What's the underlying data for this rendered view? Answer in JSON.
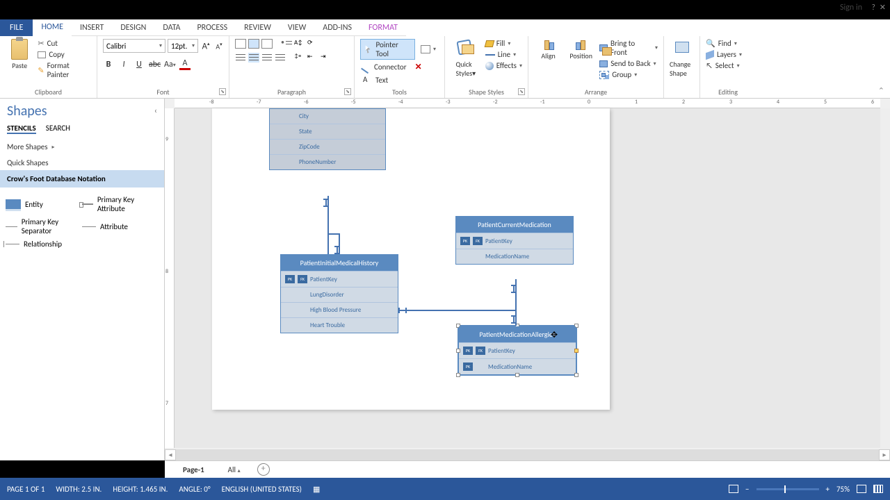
{
  "signin": "Sign in",
  "winbtns": {
    "close": "✕",
    "help": "?"
  },
  "tabs": {
    "file": "FILE",
    "home": "HOME",
    "insert": "INSERT",
    "design": "DESIGN",
    "data": "DATA",
    "process": "PROCESS",
    "review": "REVIEW",
    "view": "VIEW",
    "addins": "ADD-INS",
    "format": "FORMAT"
  },
  "ribbon": {
    "clipboard": {
      "label": "Clipboard",
      "paste": "Paste",
      "cut": "Cut",
      "copy": "Copy",
      "painter": "Format Painter"
    },
    "font": {
      "label": "Font",
      "name": "Calibri",
      "size": "12pt."
    },
    "paragraph": {
      "label": "Paragraph"
    },
    "tools": {
      "label": "Tools",
      "pointer": "Pointer Tool",
      "connector": "Connector",
      "text": "Text"
    },
    "shapestyles": {
      "label": "Shape Styles",
      "fill": "Fill",
      "line": "Line",
      "effects": "Effects"
    },
    "arrange": {
      "label": "Arrange",
      "align": "Align",
      "position": "Position",
      "front": "Bring to Front",
      "back": "Send to Back",
      "group": "Group"
    },
    "change": {
      "change": "Change Shape"
    },
    "editing": {
      "label": "Editing",
      "find": "Find",
      "layers": "Layers",
      "select": "Select"
    }
  },
  "shapespane": {
    "title": "Shapes",
    "stencils": "STENCILS",
    "search": "SEARCH",
    "more": "More Shapes",
    "quick": "Quick Shapes",
    "current": "Crow's Foot Database Notation",
    "items": {
      "entity": "Entity",
      "pka": "Primary Key Attribute",
      "pks": "Primary Key Separator",
      "attr": "Attribute",
      "rel": "Relationship"
    }
  },
  "ruler_h": [
    "-8",
    "-7",
    "-6",
    "-5",
    "-4",
    "-3",
    "-2",
    "-1",
    "0",
    "1",
    "2",
    "3",
    "4",
    "5",
    "6"
  ],
  "ruler_v": [
    "9",
    "8",
    "7"
  ],
  "entities": {
    "topfields": {
      "city": "City",
      "state": "State",
      "zip": "ZipCode",
      "phone": "PhoneNumber"
    },
    "pimh": {
      "title": "PatientInitialMedicalHistory",
      "pk": "PatientKey",
      "f1": "LungDisorder",
      "f2": "High Blood Pressure",
      "f3": "Heart Trouble"
    },
    "pcm": {
      "title": "PatientCurrentMedication",
      "pk": "PatientKey",
      "f1": "MedicationName"
    },
    "pma": {
      "title": "PatientMedicationAllergies",
      "pk": "PatientKey",
      "f1": "MedicationName"
    },
    "badge_pk": "PK",
    "badge_fk": "FK"
  },
  "pagetabs": {
    "p1": "Page-1",
    "all": "All"
  },
  "status": {
    "page": "PAGE 1 OF 1",
    "width": "WIDTH: 2.5 IN.",
    "height": "HEIGHT: 1.465 IN.",
    "angle": "ANGLE: 0°",
    "lang": "ENGLISH (UNITED STATES)",
    "zoom": "75%"
  }
}
